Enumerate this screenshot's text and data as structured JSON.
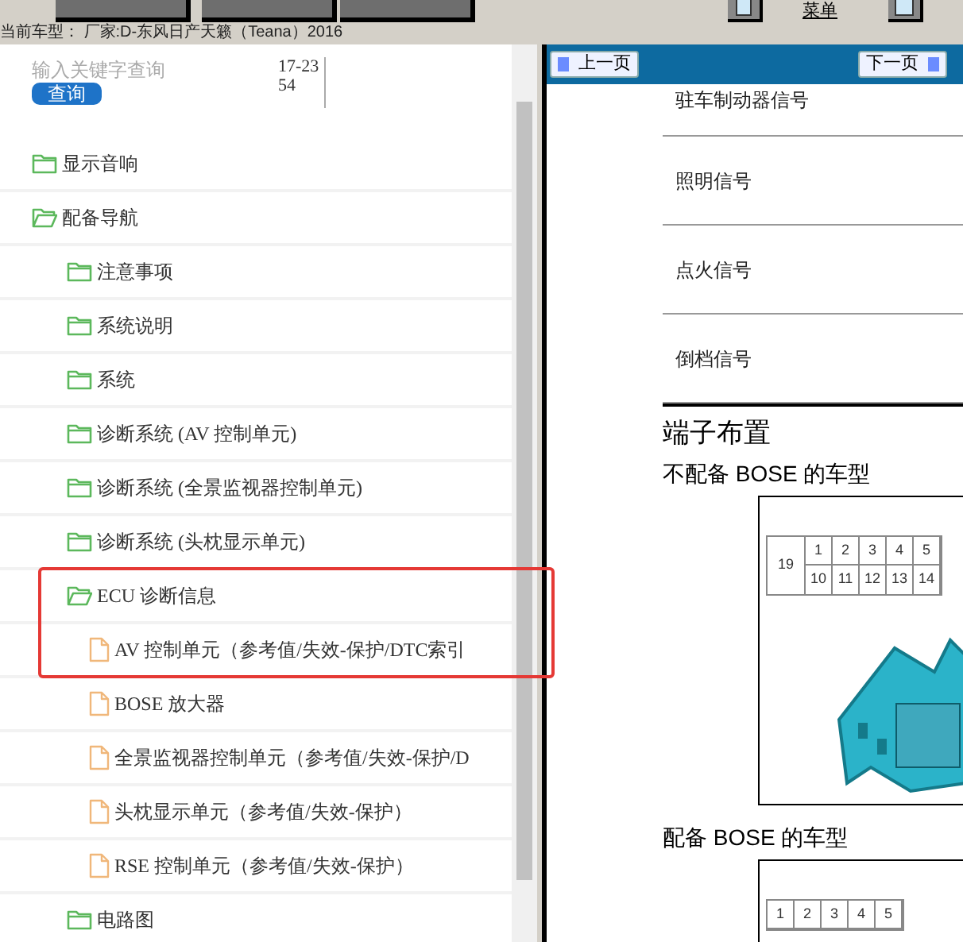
{
  "toolbar": {
    "buttons": [
      {
        "kind": "nav"
      },
      {
        "kind": "nav"
      },
      {
        "kind": "nav"
      }
    ],
    "fullscreen_menu": "菜单"
  },
  "current_model": "当前车型： 厂家:D-东风日产天籁（Teana）2016",
  "sidebar": {
    "search": {
      "placeholder": "输入关键字查询",
      "button": "查询"
    },
    "doc_code": "17-2354",
    "tree": [
      {
        "kind": "folder",
        "label": "显示音响",
        "expanded": false
      },
      {
        "kind": "folder",
        "label": "配备导航",
        "expanded": true,
        "children": [
          {
            "kind": "folder",
            "label": "注意事项",
            "expanded": false
          },
          {
            "kind": "folder",
            "label": "系统说明",
            "expanded": false
          },
          {
            "kind": "folder",
            "label": "系统",
            "expanded": false
          },
          {
            "kind": "folder",
            "label": "诊断系统 (AV 控制单元)",
            "expanded": false
          },
          {
            "kind": "folder",
            "label": "诊断系统 (全景监视器控制单元)",
            "expanded": false
          },
          {
            "kind": "folder",
            "label": "诊断系统 (头枕显示单元)",
            "expanded": false
          },
          {
            "kind": "folder",
            "label": "ECU 诊断信息",
            "expanded": true,
            "children": [
              {
                "kind": "document",
                "label": "AV 控制单元（参考值/失效-保护/DTC索引"
              },
              {
                "kind": "document",
                "label": "BOSE 放大器"
              },
              {
                "kind": "document",
                "label": "全景监视器控制单元（参考值/失效-保护/D"
              },
              {
                "kind": "document",
                "label": "头枕显示单元（参考值/失效-保护）"
              },
              {
                "kind": "document",
                "label": "RSE 控制单元（参考值/失效-保护）"
              }
            ]
          },
          {
            "kind": "folder",
            "label": "电路图",
            "expanded": false
          }
        ]
      }
    ]
  },
  "page_nav": {
    "prev": "上一页",
    "next": "下一页"
  },
  "document": {
    "signal_rows": [
      "驻车制动器信号",
      "照明信号",
      "点火信号",
      "倒档信号"
    ],
    "heading": "端子布置",
    "connectors": [
      {
        "caption": "不配备 BOSE 的车型",
        "side_pin": "19",
        "top_pins": [
          "1",
          "2",
          "3",
          "4",
          "5"
        ],
        "bottom_pins": [
          "10",
          "11",
          "12",
          "13",
          "14"
        ]
      },
      {
        "caption": "配备 BOSE 的车型",
        "top_pins": [
          "1",
          "2",
          "3",
          "4",
          "5"
        ]
      }
    ]
  }
}
